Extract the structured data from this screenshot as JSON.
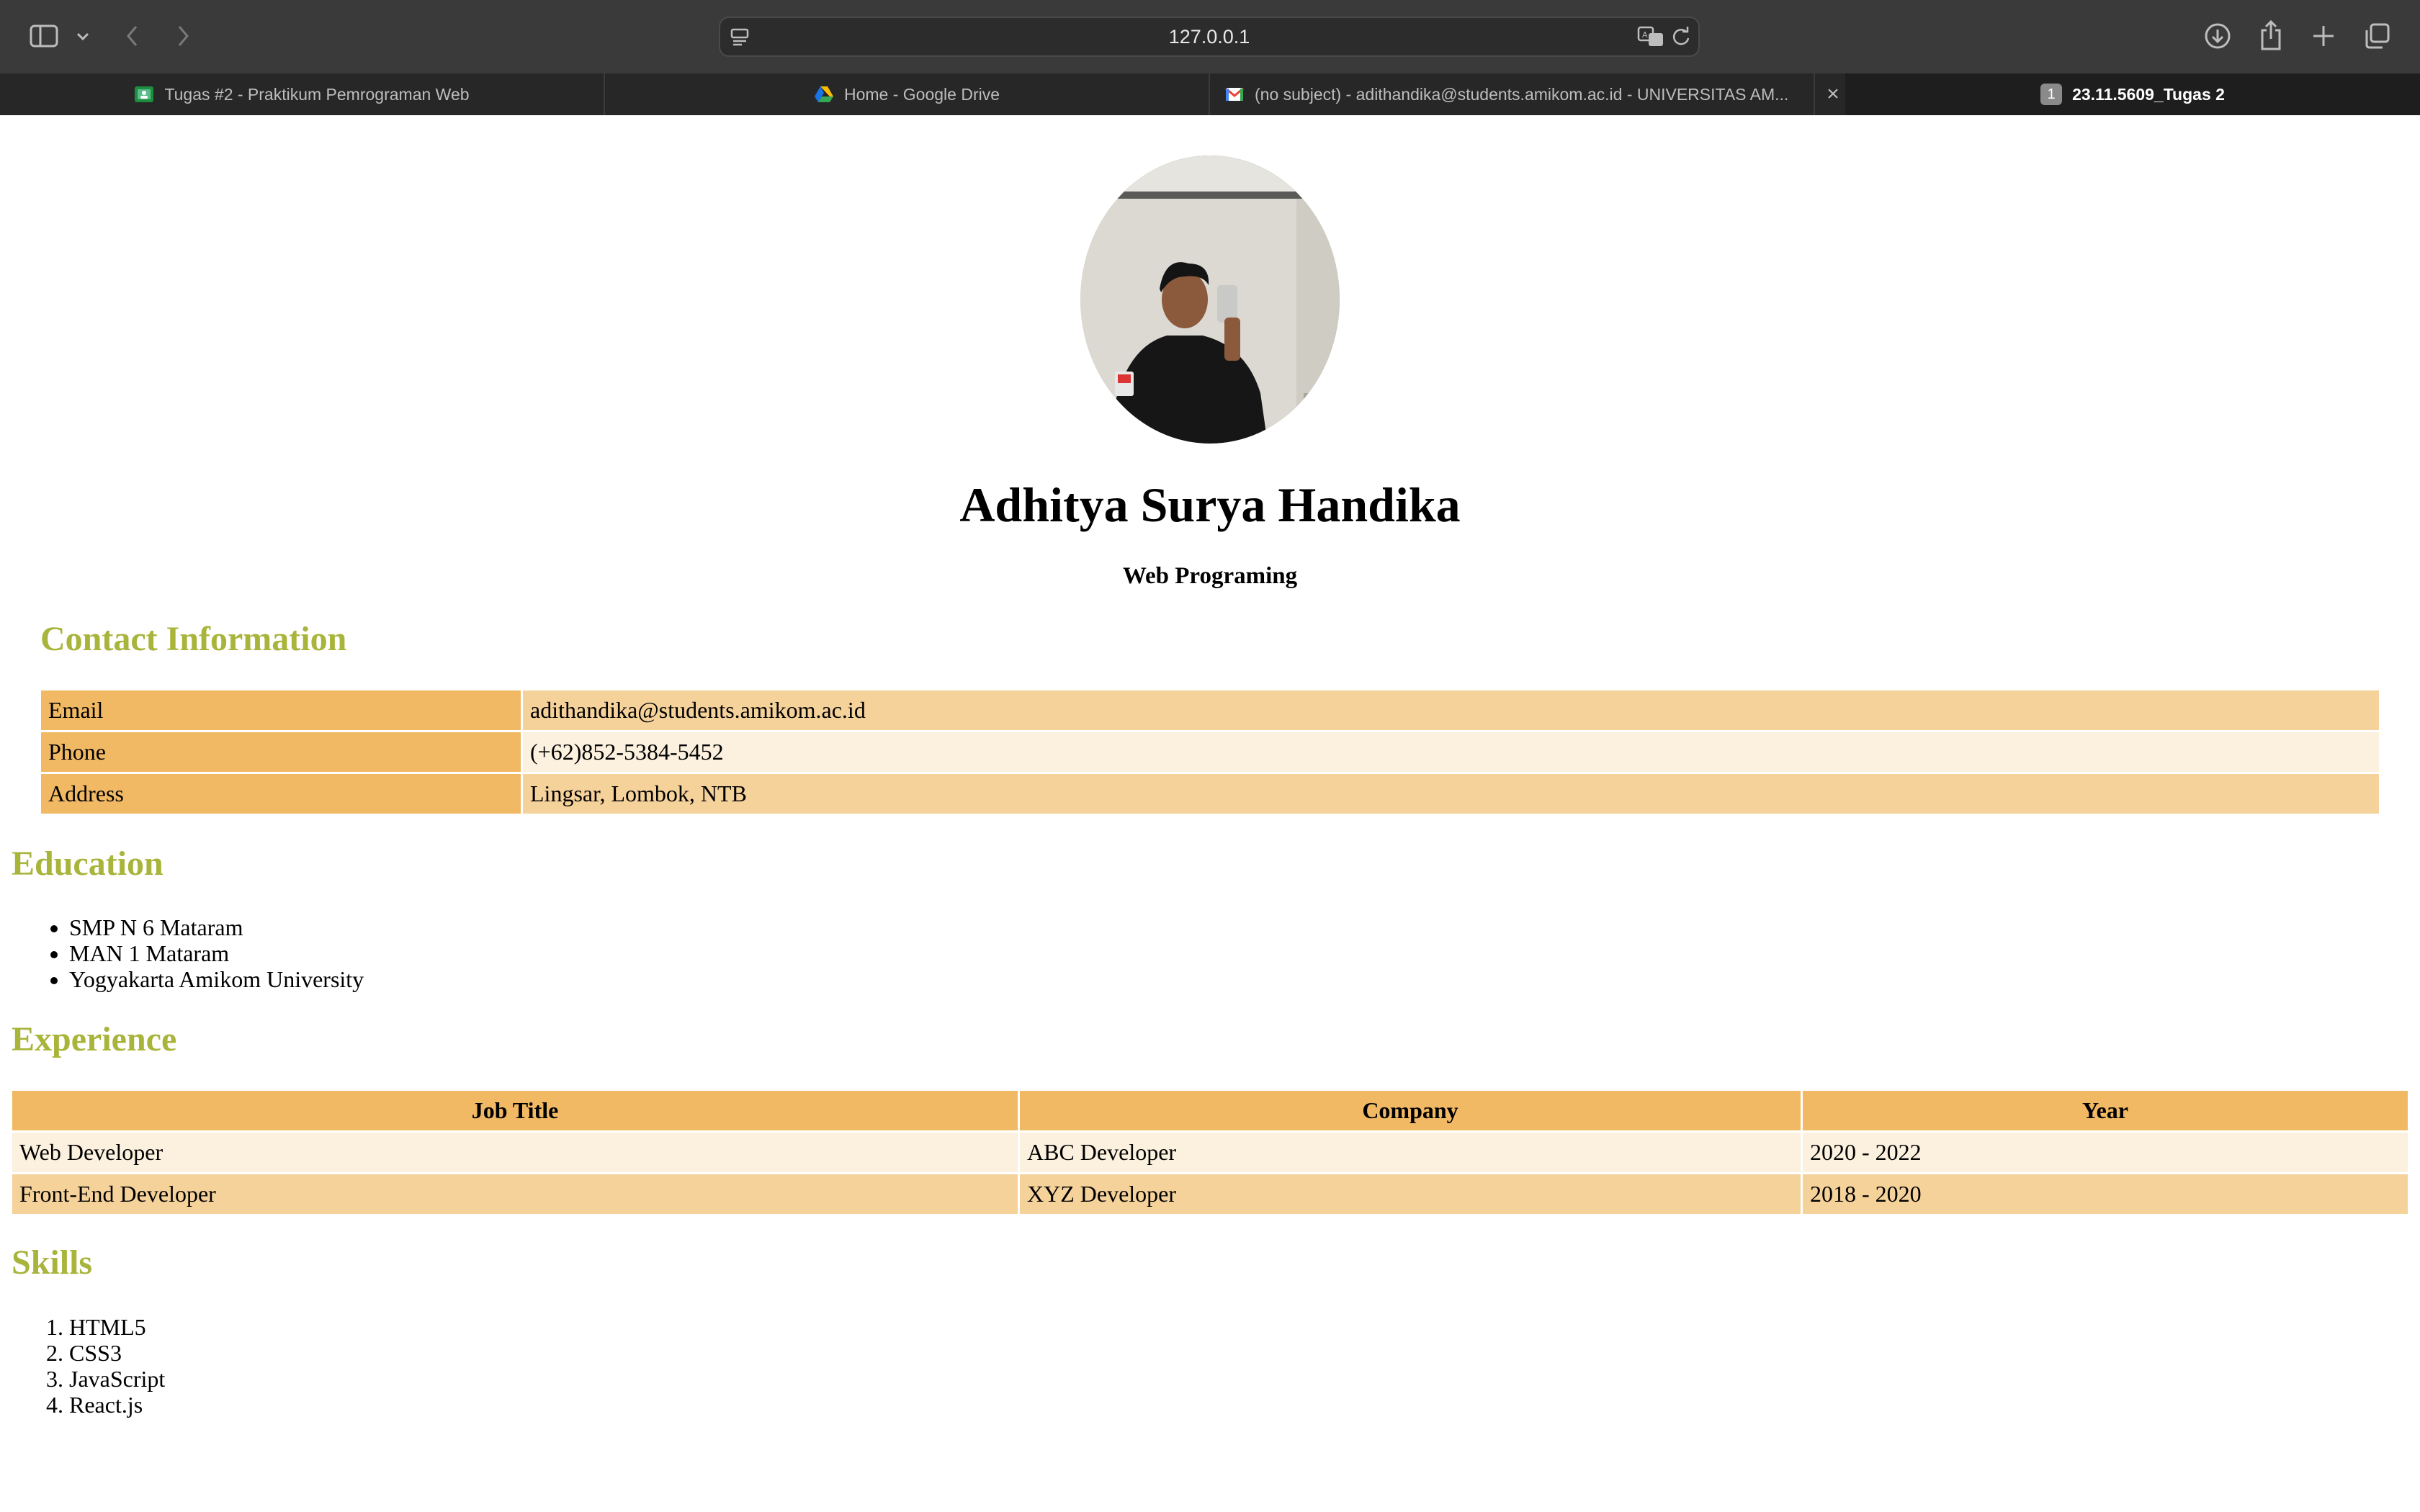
{
  "browser": {
    "url": "127.0.0.1",
    "tabs": [
      {
        "label": "Tugas #2 - Praktikum Pemrograman Web",
        "active": false
      },
      {
        "label": "Home - Google Drive",
        "active": false
      },
      {
        "label": "(no subject) - adithandika@students.amikom.ac.id - UNIVERSITAS AM...",
        "active": false
      },
      {
        "label": "23.11.5609_Tugas 2",
        "active": true
      }
    ],
    "active_tab_badge": "1",
    "close_glyph": "×"
  },
  "profile": {
    "name": "Adhitya Surya Handika",
    "subtitle": "Web Programing"
  },
  "contact": {
    "heading": "Contact Information",
    "rows": [
      {
        "label": "Email",
        "value": "adithandika@students.amikom.ac.id"
      },
      {
        "label": "Phone",
        "value": "(+62)852-5384-5452"
      },
      {
        "label": "Address",
        "value": "Lingsar, Lombok, NTB"
      }
    ]
  },
  "education": {
    "heading": "Education",
    "items": [
      "SMP N 6 Mataram",
      "MAN 1 Mataram",
      "Yogyakarta Amikom University"
    ]
  },
  "experience": {
    "heading": "Experience",
    "columns": [
      "Job Title",
      "Company",
      "Year"
    ],
    "rows": [
      [
        "Web Developer",
        "ABC Developer",
        "2020 - 2022"
      ],
      [
        "Front-End Developer",
        "XYZ Developer",
        "2018 - 2020"
      ]
    ]
  },
  "skills": {
    "heading": "Skills",
    "items": [
      "HTML5",
      "CSS3",
      "JavaScript",
      "React.js"
    ]
  },
  "colors": {
    "header_cell": "#f2b964",
    "row_dark": "#f6d29b",
    "row_light": "#fcf0de",
    "section_heading": "#a8b43a"
  },
  "icons": [
    "sidebar-icon",
    "chevron-down-icon",
    "back-icon",
    "forward-icon",
    "page-menu-icon",
    "translate-icon",
    "reload-icon",
    "download-icon",
    "share-icon",
    "new-tab-icon",
    "tab-overview-icon",
    "close-icon"
  ]
}
